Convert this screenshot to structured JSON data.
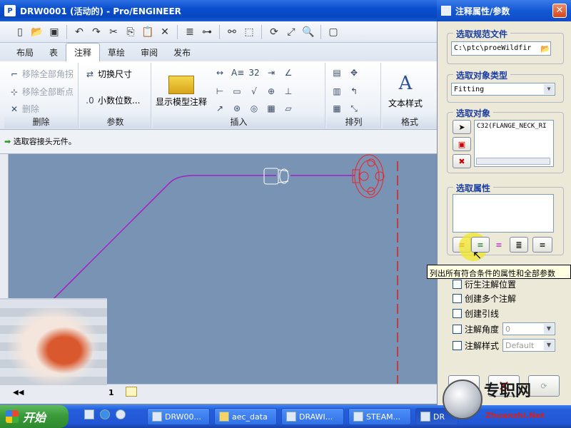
{
  "window": {
    "title": "DRW0001 (活动的) - Pro/ENGINEER"
  },
  "tabs": [
    "布局",
    "表",
    "注释",
    "草绘",
    "审阅",
    "发布"
  ],
  "active_tab": "注释",
  "ribbon": {
    "delete_group": {
      "title": "删除",
      "items": [
        "移除全部角拐",
        "移除全部断点",
        "删除"
      ]
    },
    "params_group": {
      "title": "参数",
      "items": [
        "切换尺寸",
        "小数位数..."
      ]
    },
    "insert_group": {
      "title": "插入",
      "show_model": "显示模型注释"
    },
    "arrange_group": {
      "title": "排列"
    },
    "format_group": {
      "title": "格式",
      "text_style": "文本样式"
    }
  },
  "message": "选取容接头元件。",
  "dialog": {
    "title": "注释属性/参数",
    "section_file": "选取规范文件",
    "file_path": "C:\\ptc\\proeWildfir",
    "section_type": "选取对象类型",
    "type_value": "Fitting",
    "section_object": "选取对象",
    "object_value": "C32(FLANGE_NECK_RI",
    "section_attr": "选取属性",
    "tooltip": "列出所有符合条件的属性和全部参数",
    "options": [
      "衍生注解位置",
      "创建多个注解",
      "创建引线"
    ],
    "note_angle": "注解角度",
    "note_angle_value": "0",
    "note_style": "注解样式",
    "note_style_value": "Default"
  },
  "sheet_number": "1",
  "taskbar": {
    "start": "开始",
    "tasks": [
      "DRW00...",
      "aec_data",
      "DRAWI...",
      "STEAM...",
      "DR"
    ]
  },
  "watermark": {
    "cn": "专职网",
    "en": "Zhuanzhi.Net"
  }
}
